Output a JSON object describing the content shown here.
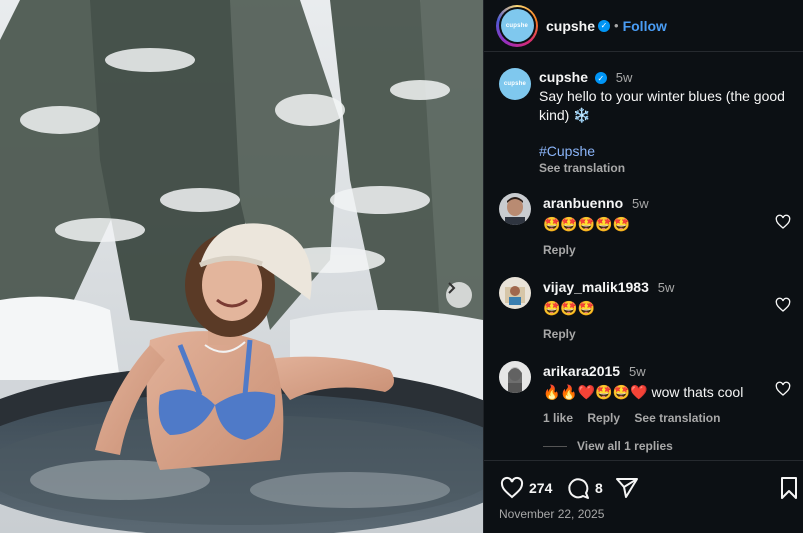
{
  "post": {
    "account": "cupshe",
    "avatar_text": "cupshe",
    "follow_label": "Follow",
    "separator": "•",
    "caption": {
      "username": "cupshe",
      "time": "5w",
      "text": "Say hello to your winter blues (the good kind) ❄️",
      "hashtag": "#Cupshe",
      "see_translation": "See translation"
    },
    "comments": [
      {
        "username": "aranbuenno",
        "time": "5w",
        "text": "🤩🤩🤩🤩🤩",
        "reply": "Reply"
      },
      {
        "username": "vijay_malik1983",
        "time": "5w",
        "text": "🤩🤩🤩",
        "reply": "Reply"
      },
      {
        "username": "arikara2015",
        "time": "5w",
        "text": "🔥🔥❤️🤩🤩❤️ wow thats cool",
        "likes": "1 like",
        "reply": "Reply",
        "see_translation": "See translation"
      }
    ],
    "view_replies": "View all 1 replies",
    "like_count": "274",
    "comment_count": "8",
    "date": "November 22, 2025"
  },
  "colors": {
    "panel_bg": "#0c1014",
    "link_blue": "#4a9df5",
    "verified_blue": "#0095f6",
    "brand_avatar": "#7fc8ee"
  },
  "icons": [
    "verified-icon",
    "heart-icon",
    "comment-icon",
    "share-icon",
    "bookmark-icon",
    "chevron-right-icon"
  ]
}
